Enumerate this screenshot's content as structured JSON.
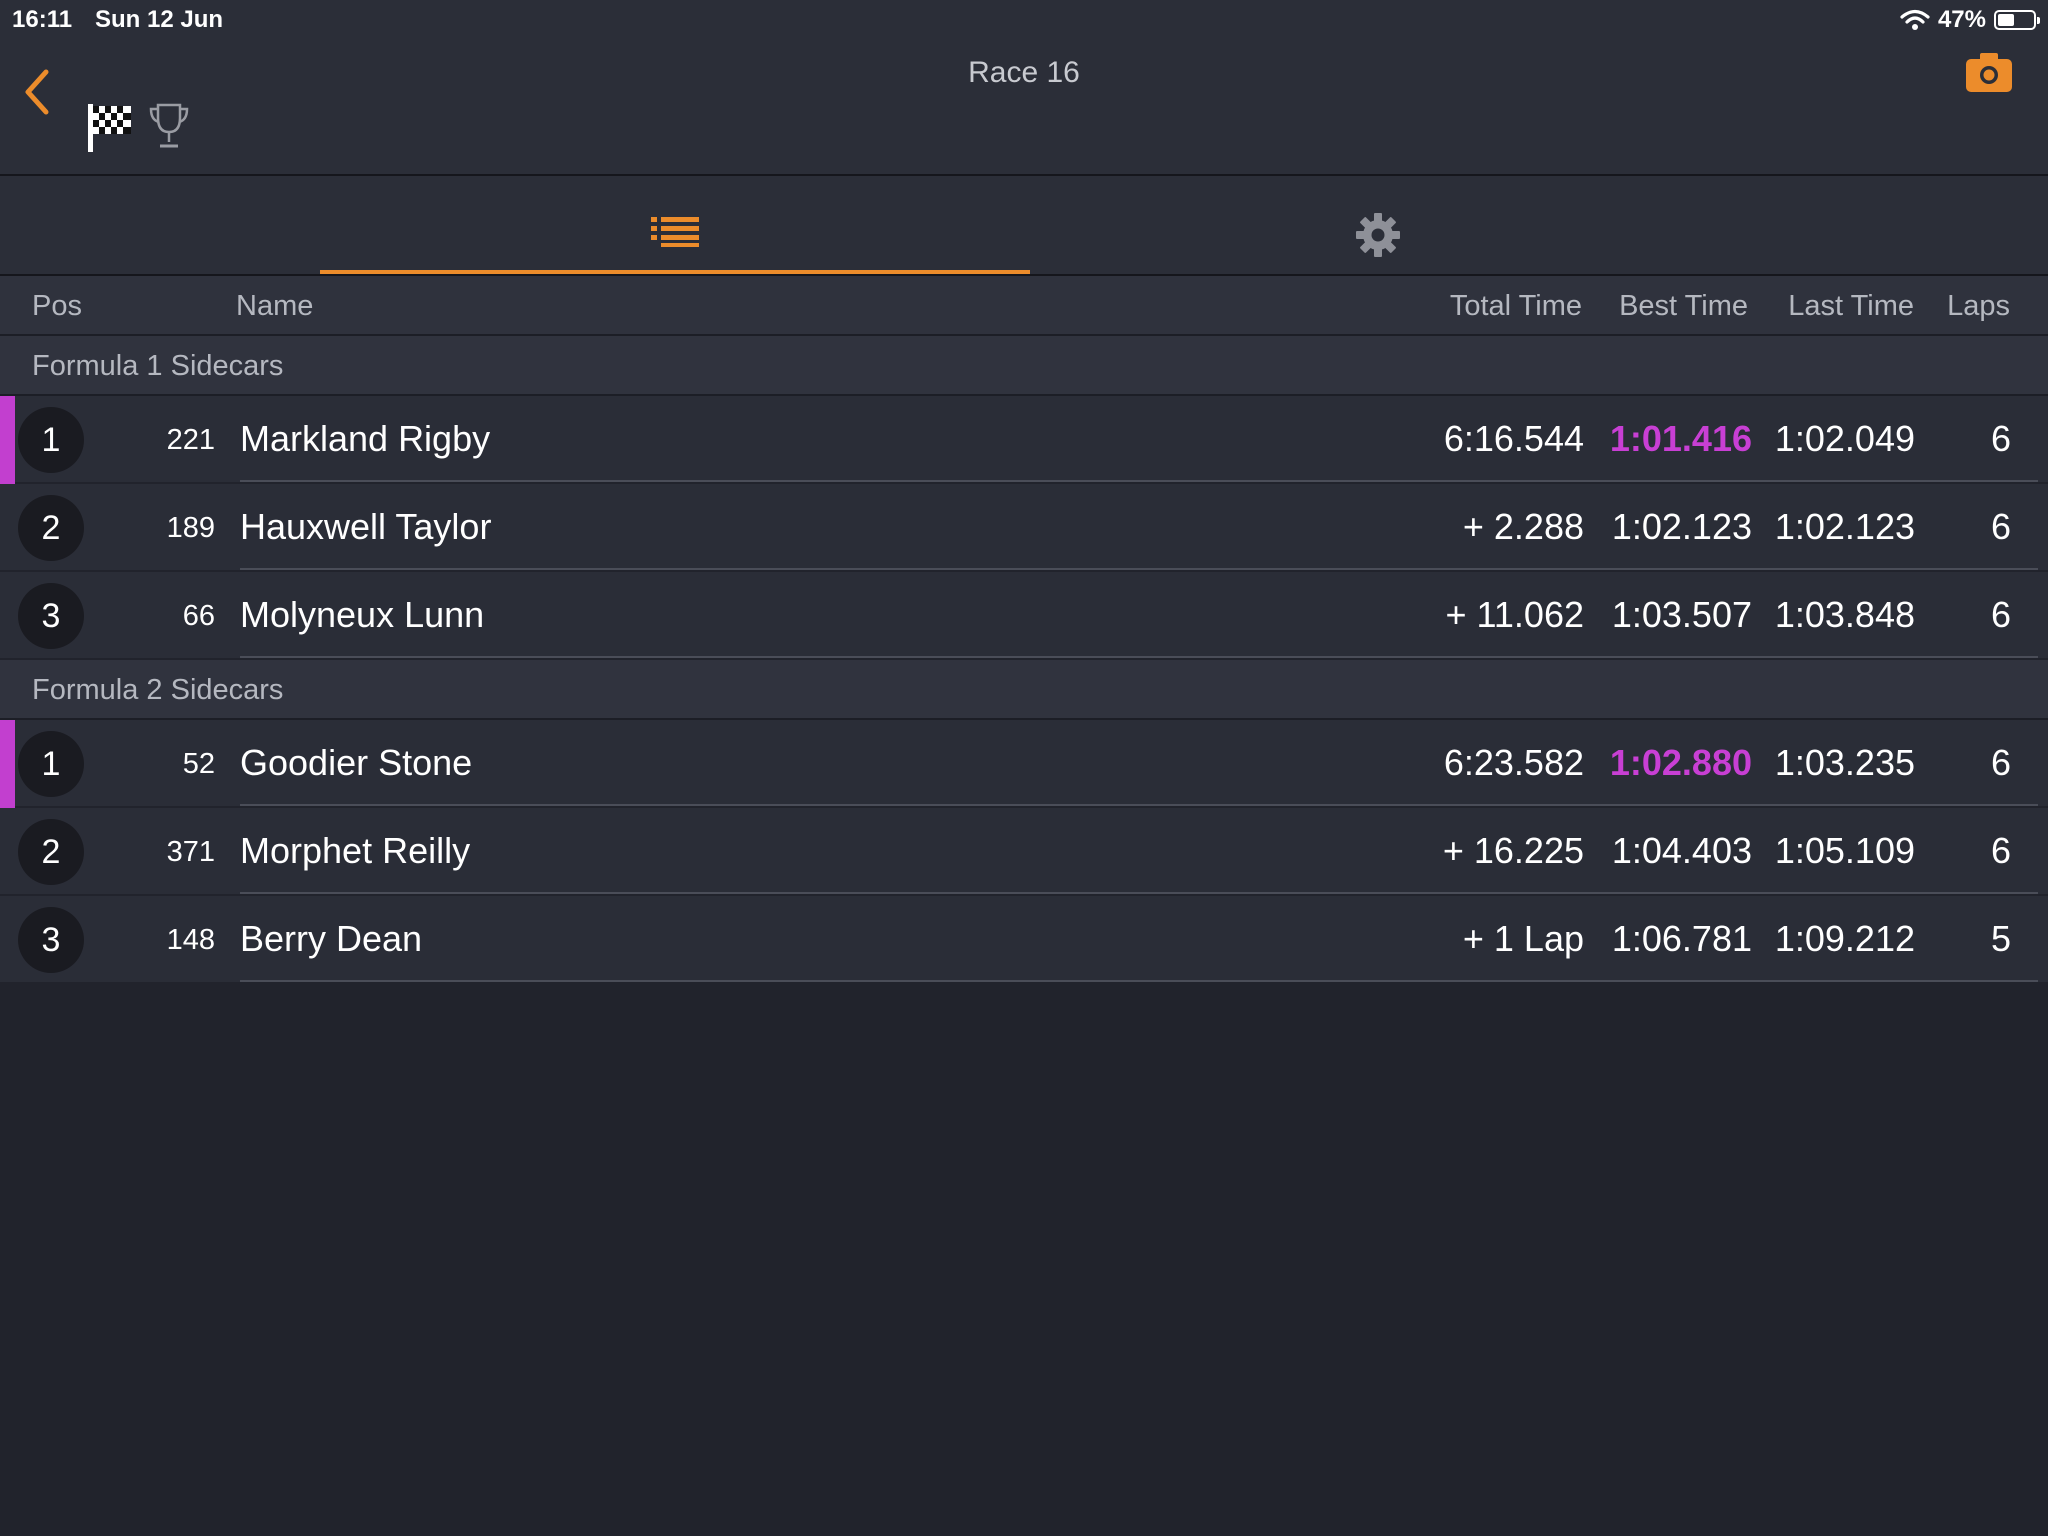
{
  "status_bar": {
    "time": "16:11",
    "date": "Sun 12 Jun",
    "battery": "47%",
    "battery_level": 0.47
  },
  "nav": {
    "title": "Race 16"
  },
  "columns": {
    "pos": "Pos",
    "name": "Name",
    "total": "Total Time",
    "best": "Best Time",
    "last": "Last Time",
    "laps": "Laps"
  },
  "colors": {
    "accent": "#ec8c2b",
    "fastest": "#c83fd4",
    "background": "#21232c"
  },
  "icons": [
    "back-chevron-icon",
    "checkered-flag-icon",
    "trophy-icon",
    "camera-icon",
    "list-icon",
    "gear-icon",
    "wifi-icon",
    "battery-icon"
  ],
  "groups": [
    {
      "name": "Formula 1 Sidecars",
      "rows": [
        {
          "pos": "1",
          "num": "221",
          "name": "Markland Rigby",
          "total": "6:16.544",
          "best": "1:01.416",
          "last": "1:02.049",
          "laps": "6"
        },
        {
          "pos": "2",
          "num": "189",
          "name": "Hauxwell Taylor",
          "total": "+ 2.288",
          "best": "1:02.123",
          "last": "1:02.123",
          "laps": "6"
        },
        {
          "pos": "3",
          "num": "66",
          "name": "Molyneux Lunn",
          "total": "+ 11.062",
          "best": "1:03.507",
          "last": "1:03.848",
          "laps": "6"
        }
      ]
    },
    {
      "name": "Formula 2 Sidecars",
      "rows": [
        {
          "pos": "1",
          "num": "52",
          "name": "Goodier Stone",
          "total": "6:23.582",
          "best": "1:02.880",
          "last": "1:03.235",
          "laps": "6"
        },
        {
          "pos": "2",
          "num": "371",
          "name": "Morphet Reilly",
          "total": "+ 16.225",
          "best": "1:04.403",
          "last": "1:05.109",
          "laps": "6"
        },
        {
          "pos": "3",
          "num": "148",
          "name": "Berry Dean",
          "total": "+ 1 Lap",
          "best": "1:06.781",
          "last": "1:09.212",
          "laps": "5"
        }
      ]
    }
  ]
}
